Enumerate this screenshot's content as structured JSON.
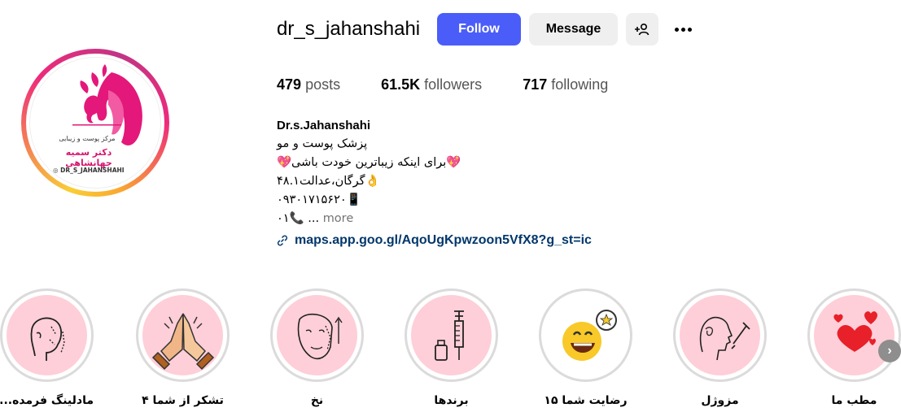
{
  "profile": {
    "username": "dr_s_jahanshahi",
    "avatar_text_1": "مرکز پوست و زیبایی",
    "avatar_text_2": "دکتر سمیه جهانشاهی",
    "avatar_handle": "DR_S_JAHANSHAHI"
  },
  "actions": {
    "follow_label": "Follow",
    "message_label": "Message",
    "add_user_icon": "person-add-icon",
    "more_icon": "more-options-icon"
  },
  "stats": {
    "posts_count": "479",
    "posts_label": "posts",
    "followers_count": "61.5K",
    "followers_label": "followers",
    "following_count": "717",
    "following_label": "following"
  },
  "bio": {
    "name": "Dr.s.Jahanshahi",
    "line1": "پزشک پوست و مو",
    "line2": "💖برای اینکه زیباترین خودت باشی💖",
    "line3": "👌گرگان،عدالت۴۸.۱",
    "line4": "۰۹۳۰۱۷۱۵۶۲۰📱",
    "line5_text": "۰۱📞 ...",
    "more_label": "more",
    "link": "maps.app.goo.gl/AqoUgKpwzoon5VfX8?g_st=ic",
    "link_icon": "link-icon"
  },
  "highlights": [
    {
      "label": "مادلینگ فرمده...",
      "icon": "face-contour-icon"
    },
    {
      "label": "تشکر از شما ۴",
      "icon": "praying-hands-icon"
    },
    {
      "label": "نخ",
      "icon": "face-lift-thread-icon"
    },
    {
      "label": "برندها",
      "icon": "syringe-vial-icon"
    },
    {
      "label": "رضایت شما ۱۵",
      "icon": "smiley-star-icon"
    },
    {
      "label": "مزوژل",
      "icon": "mesogel-injection-icon"
    },
    {
      "label": "مطب ما",
      "icon": "hearts-icon"
    }
  ],
  "colors": {
    "follow_button": "#4a5df9",
    "secondary_button": "#efefef",
    "link": "#00376b",
    "highlight_bg": "#fecfd8",
    "brand_pink": "#e3187a"
  }
}
